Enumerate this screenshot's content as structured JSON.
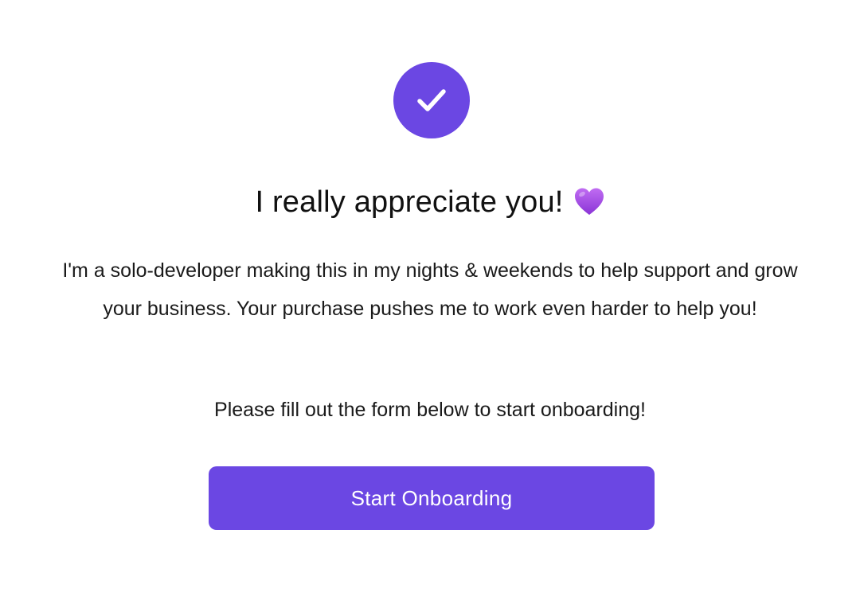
{
  "colors": {
    "accent": "#6b47e3",
    "heart": "#a34de8",
    "text": "#1a1a1a",
    "background": "#ffffff"
  },
  "icons": {
    "badge": "check-icon",
    "heading_emoji": "purple-heart-icon"
  },
  "heading": {
    "title": "I really appreciate you!"
  },
  "body": {
    "message": "I'm a solo-developer making this in my nights & weekends to help support and grow your business. Your purchase pushes me to work even harder to help you!",
    "instruction": "Please fill out the form below to start onboarding!"
  },
  "actions": {
    "start_onboarding_label": "Start Onboarding"
  }
}
